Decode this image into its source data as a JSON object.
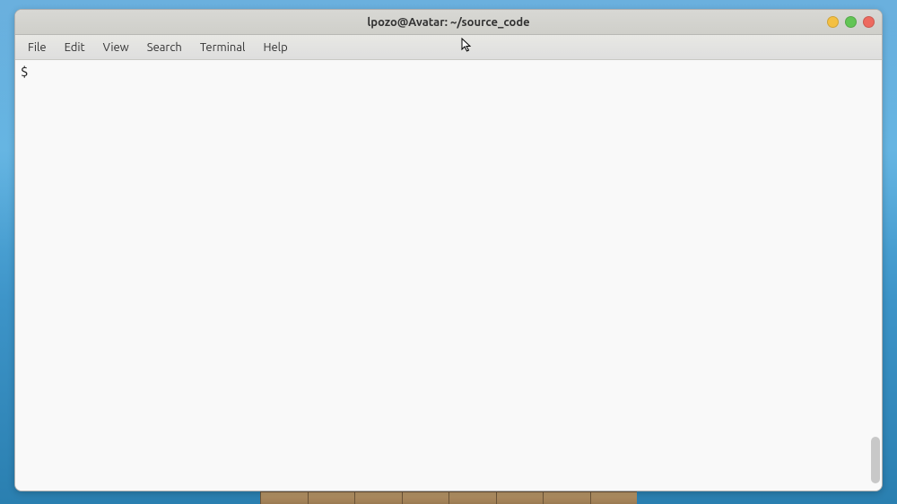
{
  "window": {
    "title": "lpozo@Avatar: ~/source_code"
  },
  "menubar": {
    "items": [
      "File",
      "Edit",
      "View",
      "Search",
      "Terminal",
      "Help"
    ]
  },
  "terminal": {
    "prompt": "$"
  }
}
